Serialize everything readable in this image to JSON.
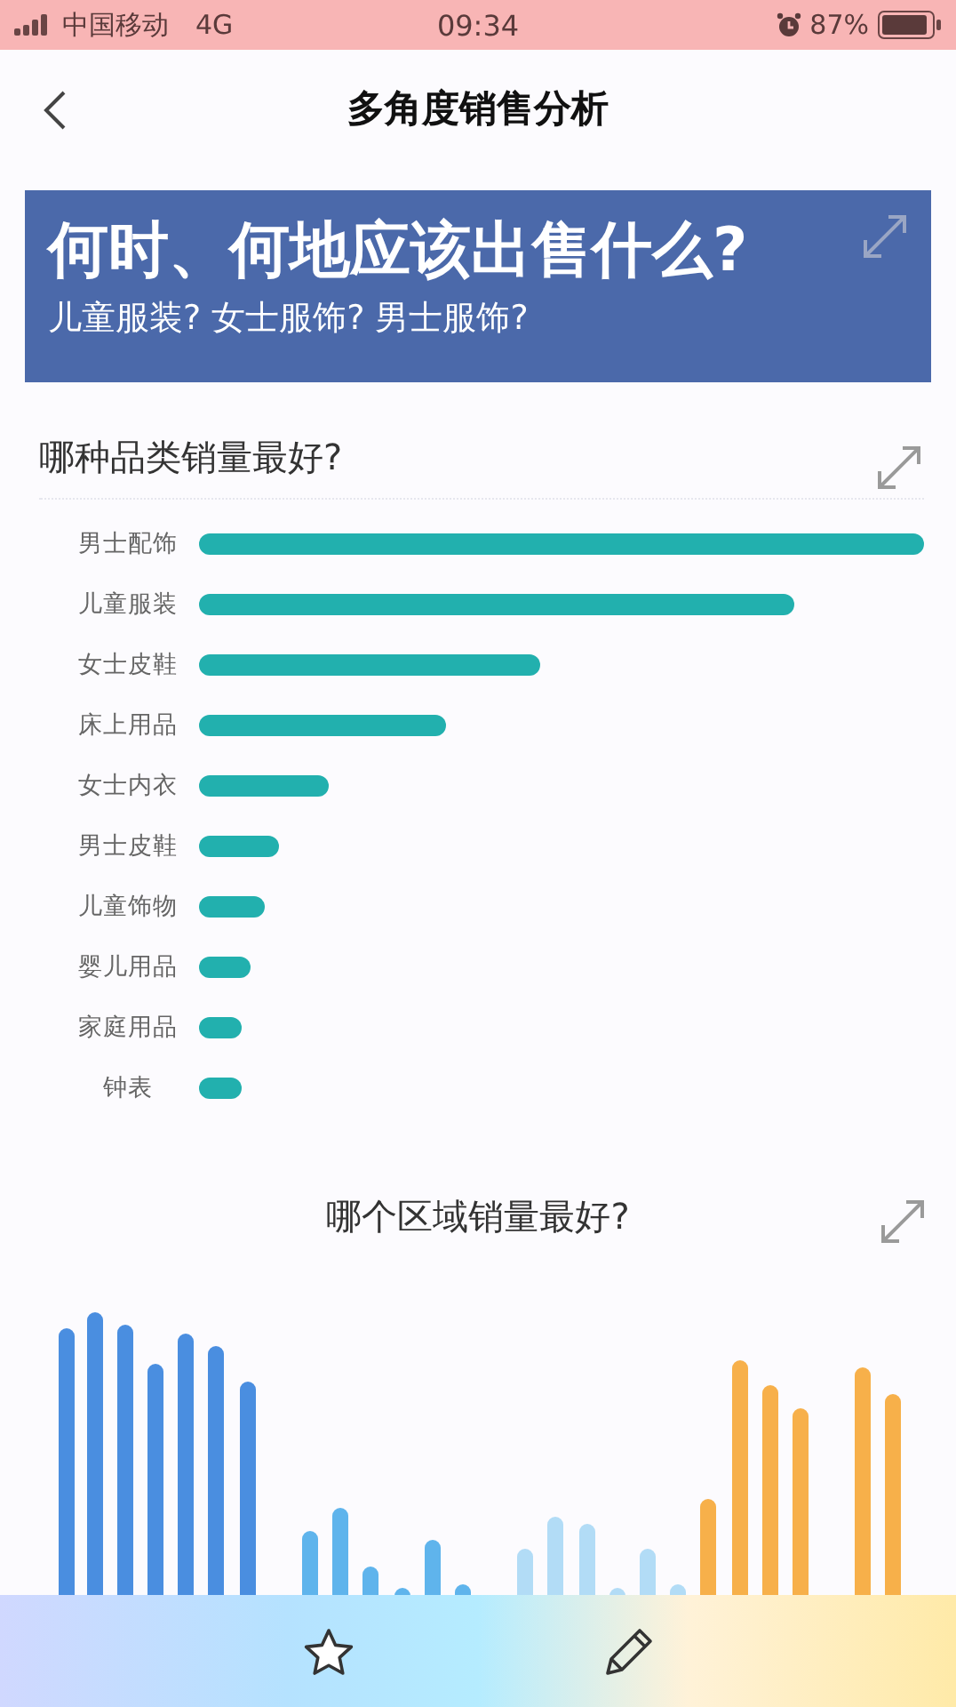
{
  "status_bar": {
    "carrier": "中国移动",
    "network": "4G",
    "time": "09:34",
    "battery": "87%"
  },
  "nav": {
    "title": "多角度销售分析"
  },
  "banner": {
    "title": "何时、何地应该出售什么?",
    "subtitle": "儿童服装? 女士服饰? 男士服饰?"
  },
  "category_card": {
    "title": "哪种品类销量最好?",
    "bars": [
      {
        "label": "男士配饰"
      },
      {
        "label": "儿童服装"
      },
      {
        "label": "女士皮鞋"
      },
      {
        "label": "床上用品"
      },
      {
        "label": "女士内衣"
      },
      {
        "label": "男士皮鞋"
      },
      {
        "label": "儿童饰物"
      },
      {
        "label": "婴儿用品"
      },
      {
        "label": "家庭用品"
      },
      {
        "label": "钟表"
      }
    ]
  },
  "region_card": {
    "title": "哪个区域销量最好?"
  }
}
